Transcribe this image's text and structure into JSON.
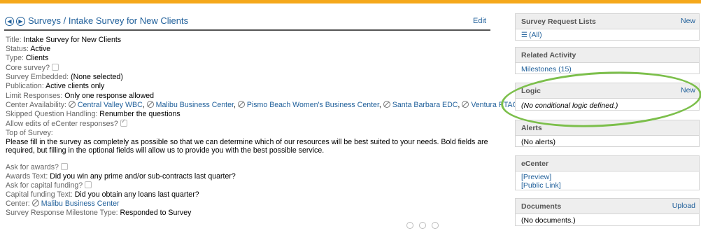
{
  "header": {
    "breadcrumb_root": "Surveys",
    "separator": "/",
    "page_title": "Intake Survey for New Clients",
    "edit_label": "Edit"
  },
  "fields": {
    "title_label": "Title:",
    "title_value": "Intake Survey for New Clients",
    "status_label": "Status:",
    "status_value": "Active",
    "type_label": "Type:",
    "type_value": "Clients",
    "core_label": "Core survey?",
    "core_checked": false,
    "embedded_label": "Survey Embedded:",
    "embedded_value": "(None selected)",
    "publication_label": "Publication:",
    "publication_value": "Active clients only",
    "limit_label": "Limit Responses:",
    "limit_value": "Only one response allowed",
    "center_avail_label": "Center Availability:",
    "centers": [
      "Central Valley WBC",
      "Malibu Business Center",
      "Pismo Beach Women's Business Center",
      "Santa Barbara EDC",
      "Ventura PTAC"
    ],
    "skipped_label": "Skipped Question Handling:",
    "skipped_value": "Renumber the questions",
    "allow_edits_label": "Allow edits of eCenter responses?",
    "allow_edits_checked": true,
    "top_label": "Top of Survey:",
    "top_text": "Please fill in the survey as completely as possible so that we can determine which of our resources will be best suited to your needs. Bold fields are required, but filling in the optional fields will allow us to provide you with the best possible service.",
    "awards_label": "Ask for awards?",
    "awards_checked": false,
    "awards_text_label": "Awards Text:",
    "awards_text_value": "Did you win any prime and/or sub-contracts last quarter?",
    "capital_label": "Ask for capital funding?",
    "capital_checked": false,
    "capital_text_label": "Capital funding Text:",
    "capital_text_value": "Did you obtain any loans last quarter?",
    "center_label": "Center:",
    "center_value": "Malibu Business Center",
    "milestone_label": "Survey Response Milestone Type:",
    "milestone_value": "Responded to Survey"
  },
  "sidebar": {
    "request_lists": {
      "title": "Survey Request Lists",
      "action": "New",
      "item": "(All)"
    },
    "related_activity": {
      "title": "Related Activity",
      "item": "Milestones (15)"
    },
    "logic": {
      "title": "Logic",
      "action": "New",
      "body": "(No conditional logic defined.)"
    },
    "alerts": {
      "title": "Alerts",
      "body": "(No alerts)"
    },
    "ecenter": {
      "title": "eCenter",
      "preview": "[Preview]",
      "public_link": "[Public Link]"
    },
    "documents": {
      "title": "Documents",
      "action": "Upload",
      "body": "(No documents.)"
    }
  },
  "colors": {
    "accent_bar": "#f5a81c",
    "link": "#1f5f9a",
    "highlight_ellipse": "#7cbf4b"
  }
}
